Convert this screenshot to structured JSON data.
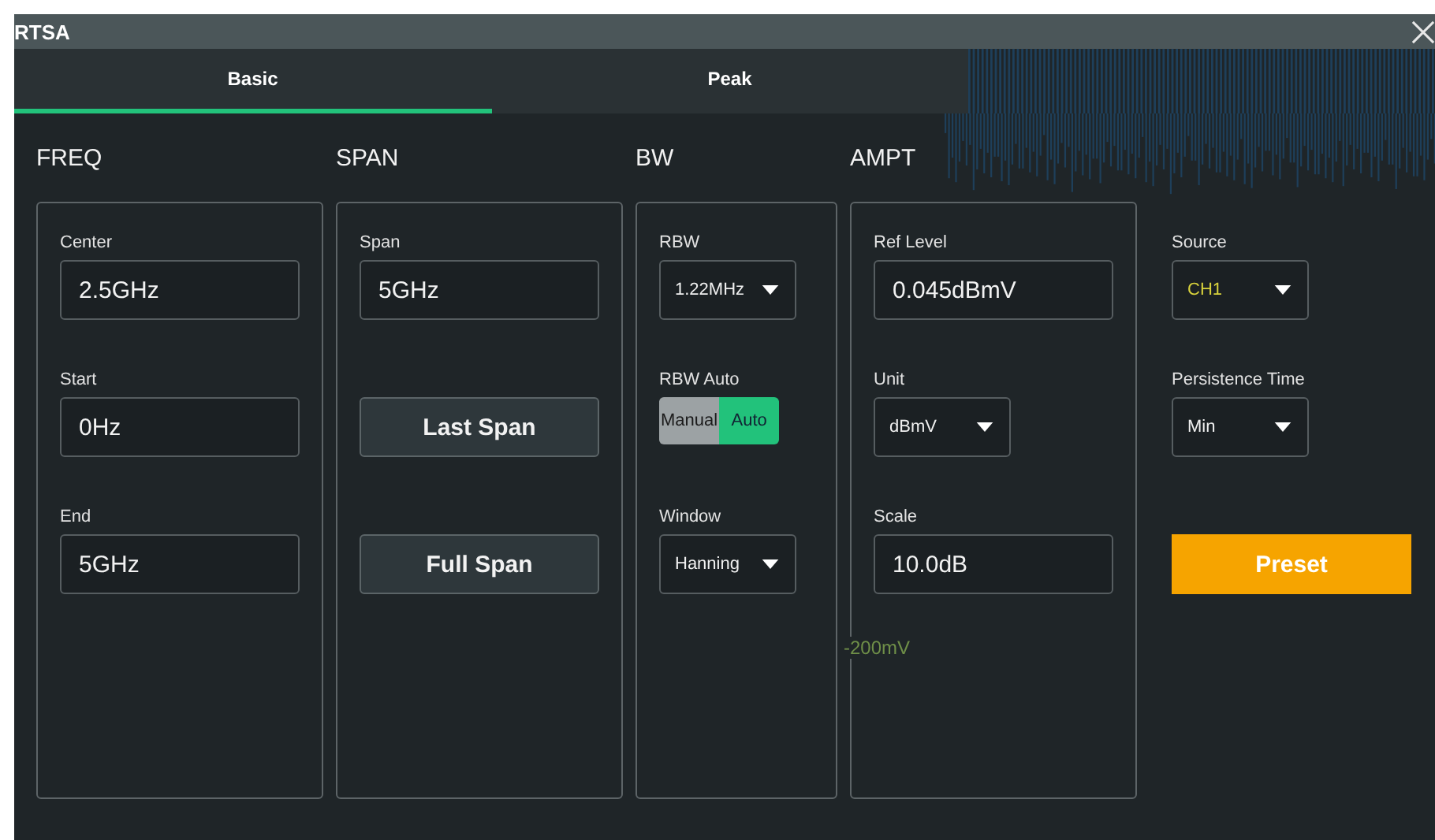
{
  "window": {
    "title": "RTSA"
  },
  "tabs": [
    {
      "label": "Basic",
      "selected": true
    },
    {
      "label": "Peak",
      "selected": false
    }
  ],
  "background_axis_label": "-200mV",
  "sections": [
    {
      "heading": "FREQ",
      "kind": "panel",
      "items": [
        {
          "kind": "field",
          "label": "Center",
          "value": "2.5GHz"
        },
        {
          "kind": "field",
          "label": "Start",
          "value": "0Hz"
        },
        {
          "kind": "field",
          "label": "End",
          "value": "5GHz"
        }
      ]
    },
    {
      "heading": "SPAN",
      "kind": "panel",
      "items": [
        {
          "kind": "field",
          "label": "Span",
          "value": "5GHz"
        },
        {
          "kind": "button",
          "label": "Last Span"
        },
        {
          "kind": "button",
          "label": "Full Span"
        }
      ]
    },
    {
      "heading": "BW",
      "kind": "panel",
      "items": [
        {
          "kind": "dropdown",
          "label": "RBW",
          "value": "1.22MHz"
        },
        {
          "kind": "toggle",
          "label": "RBW Auto",
          "options": [
            {
              "label": "Manual",
              "selected": false
            },
            {
              "label": "Auto",
              "selected": true
            }
          ]
        },
        {
          "kind": "dropdown",
          "label": "Window",
          "value": "Hanning"
        }
      ]
    },
    {
      "heading": "AMPT",
      "kind": "panel",
      "items": [
        {
          "kind": "field",
          "label": "Ref Level",
          "value": "0.045dBmV"
        },
        {
          "kind": "dropdown",
          "label": "Unit",
          "value": "dBmV"
        },
        {
          "kind": "field",
          "label": "Scale",
          "value": "10.0dB"
        }
      ]
    },
    {
      "kind": "side",
      "items": [
        {
          "kind": "dropdown",
          "label": "Source",
          "value": "CH1",
          "color": "#d8d23c"
        },
        {
          "kind": "dropdown",
          "label": "Persistence Time",
          "value": "Min"
        },
        {
          "kind": "preset",
          "label": "Preset"
        }
      ]
    }
  ]
}
